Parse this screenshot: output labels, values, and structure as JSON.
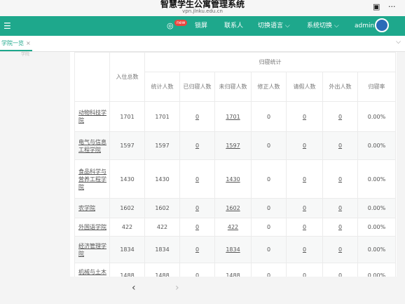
{
  "browser": {
    "title": "智慧学生公寓管理系统",
    "url": "vpn.jlnku.edu.cn",
    "tabs_icon": "tab-switcher-icon",
    "more_icon": "more-icon"
  },
  "nav": {
    "badge": "new",
    "lock": "锁屏",
    "contact": "联系人",
    "language": "切换语言",
    "system": "系统切换",
    "user": "admin"
  },
  "tabbar": {
    "active_tab": "学院一览",
    "close": "×"
  },
  "sidebar": {
    "ghost": "学院"
  },
  "table": {
    "header_top": {
      "total": "入住总数",
      "group": "归寝统计"
    },
    "header_sub": [
      "统计人数",
      "已归寝人数",
      "未归寝人数",
      "修正人数",
      "请假人数",
      "外出人数",
      "归寝率"
    ],
    "rows": [
      {
        "name": "动物科技学院",
        "total": "1701",
        "count": "1701",
        "returned": "0",
        "not_returned": "1701",
        "corrected": "0",
        "leave": "0",
        "out": "0",
        "rate": "0.00%"
      },
      {
        "name": "电气与信息工程学院",
        "total": "1597",
        "count": "1597",
        "returned": "0",
        "not_returned": "1597",
        "corrected": "0",
        "leave": "0",
        "out": "0",
        "rate": "0.00%"
      },
      {
        "name": "食品科学与营养工程学院",
        "total": "1430",
        "count": "1430",
        "returned": "0",
        "not_returned": "1430",
        "corrected": "0",
        "leave": "0",
        "out": "0",
        "rate": "0.00%"
      },
      {
        "name": "农学院",
        "total": "1602",
        "count": "1602",
        "returned": "0",
        "not_returned": "1602",
        "corrected": "0",
        "leave": "0",
        "out": "0",
        "rate": "0.00%"
      },
      {
        "name": "外国语学院",
        "total": "422",
        "count": "422",
        "returned": "0",
        "not_returned": "422",
        "corrected": "0",
        "leave": "0",
        "out": "0",
        "rate": "0.00%"
      },
      {
        "name": "经济管理学院",
        "total": "1834",
        "count": "1834",
        "returned": "0",
        "not_returned": "1834",
        "corrected": "0",
        "leave": "0",
        "out": "0",
        "rate": "0.00%"
      },
      {
        "name": "机械与土木工程学院",
        "total": "1488",
        "count": "1488",
        "returned": "0",
        "not_returned": "1488",
        "corrected": "0",
        "leave": "0",
        "out": "0",
        "rate": "0.00%"
      }
    ]
  },
  "footer": {
    "back": "‹",
    "forward": "›"
  }
}
